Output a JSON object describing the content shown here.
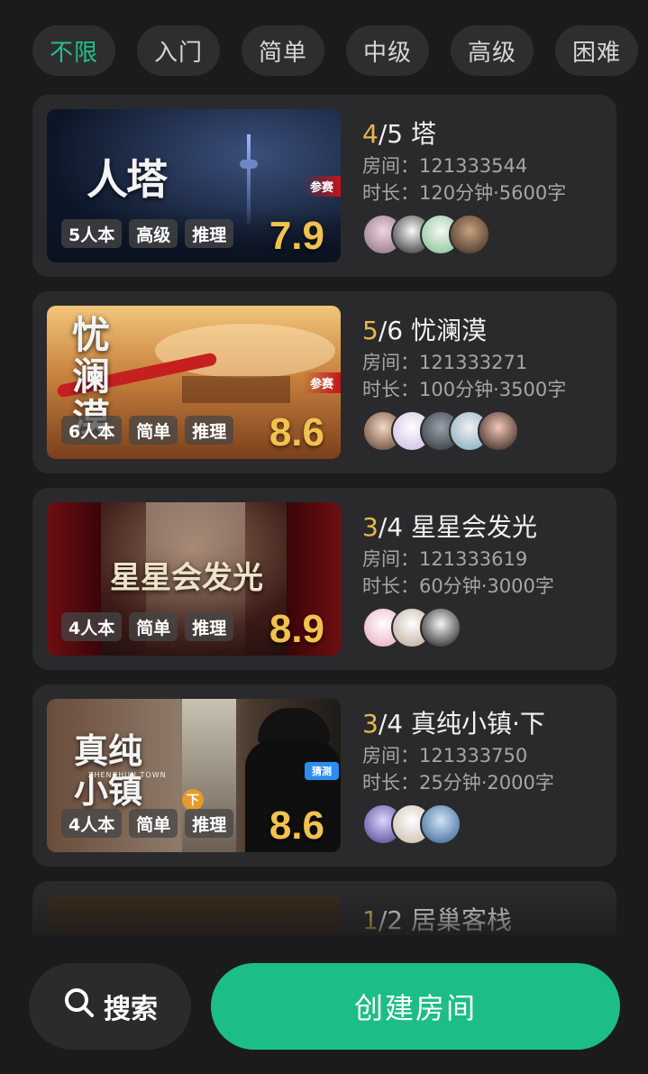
{
  "filters": [
    {
      "label": "不限",
      "active": true
    },
    {
      "label": "入门",
      "active": false
    },
    {
      "label": "简单",
      "active": false
    },
    {
      "label": "中级",
      "active": false
    },
    {
      "label": "高级",
      "active": false
    },
    {
      "label": "困难",
      "active": false
    }
  ],
  "rooms": [
    {
      "count_current": "4",
      "count_rest": "/5",
      "name": "塔",
      "room_label": "房间：121333544",
      "duration_label": "时长：120分钟·5600字",
      "tags": [
        "5人本",
        "高级",
        "推理"
      ],
      "score": "7.9",
      "thumb_title": "人塔",
      "badge": "参赛"
    },
    {
      "count_current": "5",
      "count_rest": "/6",
      "name": "忧澜漠",
      "room_label": "房间：121333271",
      "duration_label": "时长：100分钟·3500字",
      "tags": [
        "6人本",
        "简单",
        "推理"
      ],
      "score": "8.6",
      "thumb_title": "忧澜漠",
      "badge": "参赛"
    },
    {
      "count_current": "3",
      "count_rest": "/4",
      "name": "星星会发光",
      "room_label": "房间：121333619",
      "duration_label": "时长：60分钟·3000字",
      "tags": [
        "4人本",
        "简单",
        "推理"
      ],
      "score": "8.9",
      "thumb_title": "星星会发光"
    },
    {
      "count_current": "3",
      "count_rest": "/4",
      "name": "真纯小镇·下",
      "room_label": "房间：121333750",
      "duration_label": "时长：25分钟·2000字",
      "tags": [
        "4人本",
        "简单",
        "推理"
      ],
      "score": "8.6",
      "thumb_title": "真纯小镇",
      "thumb_subtitle": "ZHENCHUN TOWN",
      "thumb_mark": "下",
      "badge": "猜测"
    },
    {
      "count_current": "1",
      "count_rest": "/2",
      "name": "居巢客栈",
      "room_label": "",
      "duration_label": "",
      "tags": [],
      "score": ""
    }
  ],
  "bottom": {
    "search_label": "搜索",
    "create_label": "创建房间"
  },
  "colors": {
    "accent": "#1dbd87",
    "active_filter": "#21c08b",
    "score": "#f1c24e",
    "count_current": "#e7b84a"
  }
}
